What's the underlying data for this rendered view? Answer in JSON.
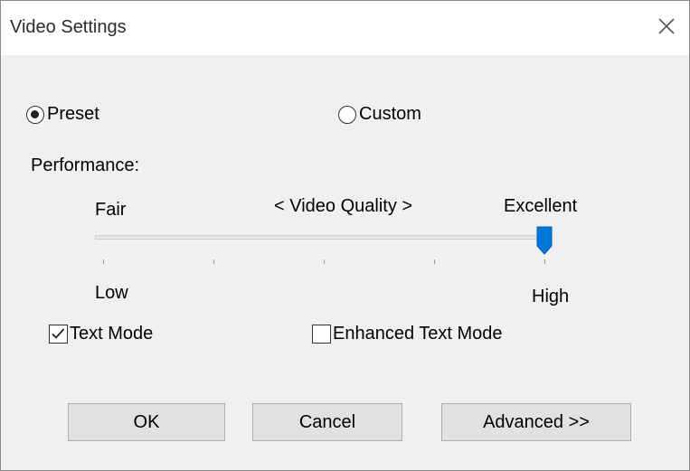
{
  "window": {
    "title": "Video Settings",
    "close_icon": "close-icon"
  },
  "mode": {
    "preset_label": "Preset",
    "custom_label": "Custom",
    "selected": "Preset"
  },
  "performance": {
    "label": "Performance:",
    "fair_label": "Fair",
    "quality_label": "< Video Quality >",
    "excellent_label": "Excellent",
    "low_label": "Low",
    "high_label": "High",
    "slider_value_fraction": 1.0,
    "slider_positions": 5
  },
  "options": {
    "text_mode_label": "Text Mode",
    "text_mode_checked": true,
    "enhanced_text_mode_label": "Enhanced Text Mode",
    "enhanced_text_mode_checked": false
  },
  "buttons": {
    "ok_label": "OK",
    "cancel_label": "Cancel",
    "advanced_label": "Advanced >>"
  },
  "colors": {
    "accent": "#0078d7",
    "window_bg": "#f0f0f0",
    "button_bg": "#e1e1e1"
  }
}
